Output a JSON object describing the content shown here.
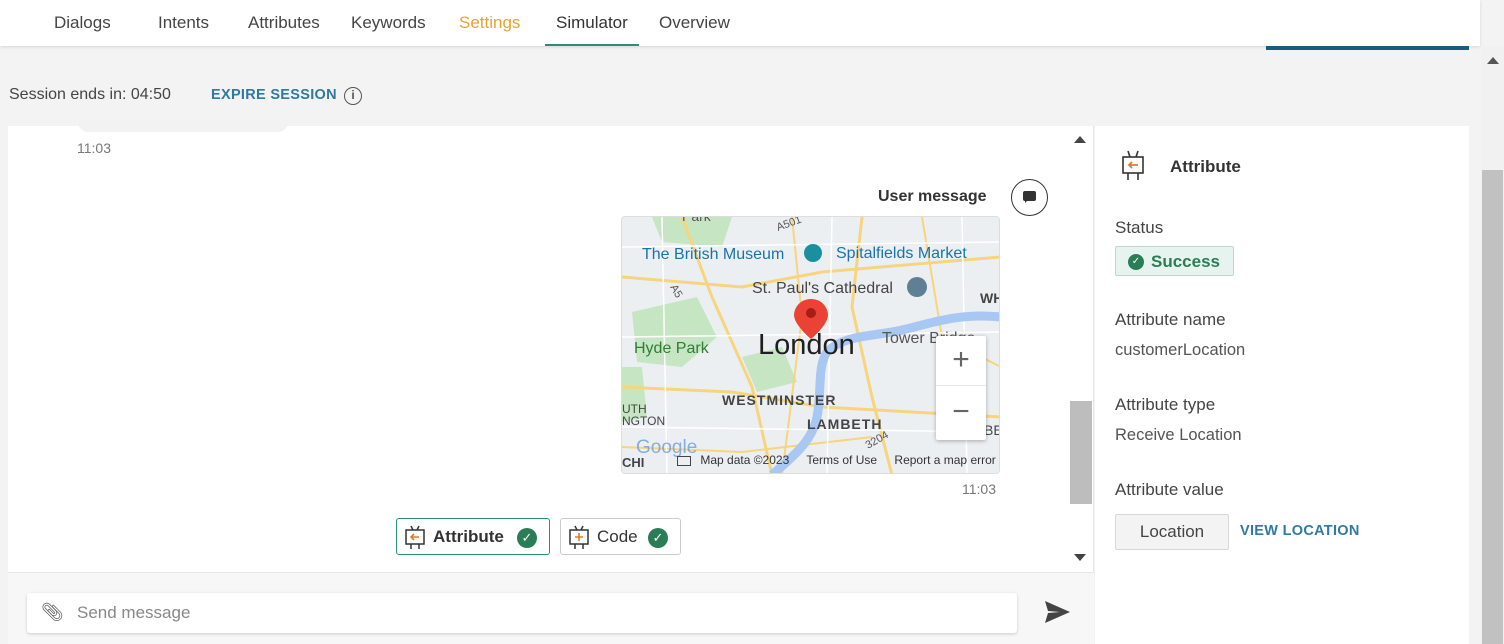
{
  "tabs": {
    "dialogs": "Dialogs",
    "intents": "Intents",
    "attributes": "Attributes",
    "keywords": "Keywords",
    "settings": "Settings",
    "simulator": "Simulator",
    "overview": "Overview"
  },
  "session": {
    "label": "Session ends in: 04:50",
    "expire": "EXPIRE SESSION",
    "info_icon": "info-icon"
  },
  "chat": {
    "time_first": "11:03",
    "user_message_label": "User message",
    "time_map": "11:03",
    "map": {
      "city": "London",
      "places": [
        "The British Museum",
        "Spitalfields Market",
        "St. Paul's Cathedral",
        "Hyde Park",
        "Tower Bridge",
        "WESTMINSTER",
        "LAMBETH",
        "Park",
        "WH",
        "UTH",
        "NGTON",
        "BE",
        "A501",
        "A5",
        "3204",
        "CHI"
      ],
      "zoom_in": "+",
      "zoom_out": "−",
      "footer": {
        "brand": "Google",
        "data": "Map data ©2023",
        "terms": "Terms of Use",
        "report": "Report a map error"
      }
    },
    "chips": {
      "attribute": "Attribute",
      "code": "Code"
    },
    "composer": {
      "placeholder": "Send message"
    }
  },
  "side": {
    "title": "Attribute",
    "status_label": "Status",
    "status_value": "Success",
    "name_label": "Attribute name",
    "name_value": "customerLocation",
    "type_label": "Attribute type",
    "type_value": "Receive Location",
    "value_label": "Attribute value",
    "value_button": "Location",
    "view_location": "VIEW LOCATION"
  },
  "colors": {
    "accent_green": "#2a8f77",
    "success_green": "#2a7d56",
    "link_blue": "#2f7aa0",
    "settings_orange": "#e6a333"
  }
}
